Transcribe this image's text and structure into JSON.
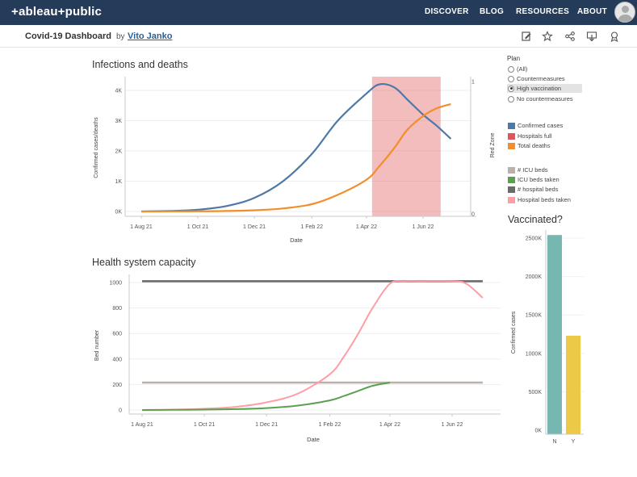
{
  "header": {
    "logo": "+ableau+public",
    "nav": [
      "DISCOVER",
      "BLOG",
      "RESOURCES",
      "ABOUT"
    ]
  },
  "subheader": {
    "title": "Covid-19 Dashboard",
    "by": "by",
    "author": "Vito Janko",
    "icons": [
      "edit-icon",
      "star-icon",
      "share-icon",
      "download-icon",
      "award-icon"
    ]
  },
  "sections": {
    "infections_title": "Infections and deaths",
    "health_title": "Health system capacity",
    "vaccinated_title": "Vaccinated?"
  },
  "plan_filter": {
    "title": "Plan",
    "options": [
      "(All)",
      "Countermeasures",
      "High vaccination",
      "No countermeasures"
    ],
    "selected": "High vaccination"
  },
  "legend1": [
    {
      "label": "Confirmed cases",
      "color": "#4e79a7"
    },
    {
      "label": "Hospitals full",
      "color": "#e15759"
    },
    {
      "label": "Total deaths",
      "color": "#f28e2b"
    }
  ],
  "legend2": [
    {
      "label": "# ICU beds",
      "color": "#bab0ac"
    },
    {
      "label": "ICU beds taken",
      "color": "#59a14f"
    },
    {
      "label": "# hospital beds",
      "color": "#6b6b6b"
    },
    {
      "label": "Hospital beds taken",
      "color": "#ff9da7"
    }
  ],
  "chart_data": [
    {
      "type": "line",
      "title": "Infections and deaths",
      "xlabel": "Date",
      "ylabel": "Confirmed cases/deaths",
      "y2label": "Red Zone",
      "x_ticks": [
        "1 Aug 21",
        "1 Oct 21",
        "1 Dec 21",
        "1 Feb 22",
        "1 Apr 22",
        "1 Jun 22"
      ],
      "y_ticks": [
        "0K",
        "1K",
        "2K",
        "3K",
        "4K"
      ],
      "y2_ticks": [
        "0",
        "1"
      ],
      "ylim": [
        0,
        4500
      ],
      "x": [
        "1 Aug 21",
        "1 Sep 21",
        "1 Oct 21",
        "1 Nov 21",
        "1 Dec 21",
        "1 Jan 22",
        "1 Feb 22",
        "1 Mar 22",
        "1 Apr 22",
        "15 Apr 22",
        "1 May 22",
        "15 May 22",
        "1 Jun 22",
        "15 Jun 22",
        "1 Jul 22"
      ],
      "series": [
        {
          "name": "Confirmed cases",
          "color": "#4e79a7",
          "values": [
            0,
            20,
            60,
            180,
            450,
            1000,
            1900,
            3000,
            3900,
            4200,
            4100,
            3700,
            3200,
            2850,
            2400
          ]
        },
        {
          "name": "Total deaths",
          "color": "#f28e2b",
          "values": [
            0,
            2,
            5,
            15,
            40,
            100,
            240,
            550,
            1050,
            1500,
            2100,
            2700,
            3150,
            3400,
            3550
          ]
        }
      ],
      "red_zone": {
        "name": "Hospitals full",
        "color": "#e15759",
        "from": "7 Apr 22",
        "to": "20 Jun 22",
        "value": 1
      }
    },
    {
      "type": "line",
      "title": "Health system capacity",
      "xlabel": "Date",
      "ylabel": "Bed number",
      "x_ticks": [
        "1 Aug 21",
        "1 Oct 21",
        "1 Dec 21",
        "1 Feb 22",
        "1 Apr 22",
        "1 Jun 22"
      ],
      "y_ticks": [
        "0",
        "200",
        "400",
        "600",
        "800",
        "1000"
      ],
      "ylim": [
        0,
        1050
      ],
      "x": [
        "1 Aug 21",
        "1 Sep 21",
        "1 Oct 21",
        "1 Nov 21",
        "1 Dec 21",
        "1 Jan 22",
        "1 Feb 22",
        "15 Feb 22",
        "1 Mar 22",
        "15 Mar 22",
        "1 Apr 22",
        "15 Apr 22",
        "1 May 22",
        "1 Jun 22",
        "15 Jun 22",
        "1 Jul 22"
      ],
      "series": [
        {
          "name": "# hospital beds",
          "color": "#6b6b6b",
          "values": [
            1010,
            1010,
            1010,
            1010,
            1010,
            1010,
            1010,
            1010,
            1010,
            1010,
            1010,
            1010,
            1010,
            1010,
            1010,
            1010
          ]
        },
        {
          "name": "# ICU beds",
          "color": "#bab0ac",
          "values": [
            215,
            215,
            215,
            215,
            215,
            215,
            215,
            215,
            215,
            215,
            215,
            215,
            215,
            215,
            215,
            215
          ]
        },
        {
          "name": "Hospital beds taken",
          "color": "#ff9da7",
          "values": [
            0,
            3,
            10,
            25,
            60,
            130,
            280,
            420,
            600,
            800,
            990,
            1010,
            1010,
            1010,
            990,
            880
          ]
        },
        {
          "name": "ICU beds taken",
          "color": "#59a14f",
          "values": [
            0,
            1,
            3,
            7,
            15,
            35,
            75,
            110,
            150,
            190,
            215,
            null,
            null,
            null,
            null,
            null
          ]
        }
      ]
    },
    {
      "type": "bar",
      "title": "Vaccinated?",
      "ylabel": "Confirmed cases",
      "categories": [
        "N",
        "Y"
      ],
      "values": [
        2540000,
        1230000
      ],
      "colors": [
        "#76b7b2",
        "#edc948"
      ],
      "y_ticks": [
        "0K",
        "500K",
        "1000K",
        "1500K",
        "2000K",
        "2500K"
      ],
      "ylim": [
        0,
        2700000
      ]
    }
  ]
}
